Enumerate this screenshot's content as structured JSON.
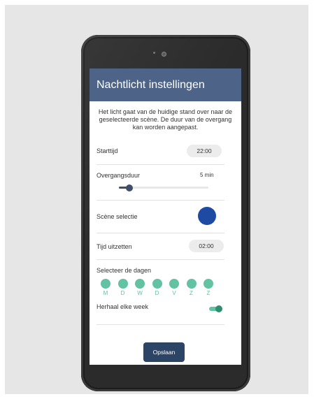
{
  "header": {
    "title": "Nachtlicht instellingen"
  },
  "intro": "Het licht gaat van de huidige stand over naar de geselecteerde scène. De duur van de overgang kan worden aangepast.",
  "start_time": {
    "label": "Starttijd",
    "value": "22:00"
  },
  "transition": {
    "label": "Overgangsduur",
    "value": "5 min",
    "level_fraction": 0.12
  },
  "scene": {
    "label": "Scène selectie",
    "color": "#1f4aa3"
  },
  "off_time": {
    "label": "Tijd uitzetten",
    "value": "02:00"
  },
  "days": {
    "label": "Selecteer de dagen",
    "items": [
      "M",
      "D",
      "W",
      "D",
      "V",
      "Z",
      "Z"
    ],
    "color": "#62c2a2"
  },
  "repeat": {
    "label": "Herhaal elke week",
    "enabled": true
  },
  "save_label": "Opslaan",
  "colors": {
    "header": "#4d6488",
    "button": "#2c4567",
    "accent": "#62c2a2"
  }
}
